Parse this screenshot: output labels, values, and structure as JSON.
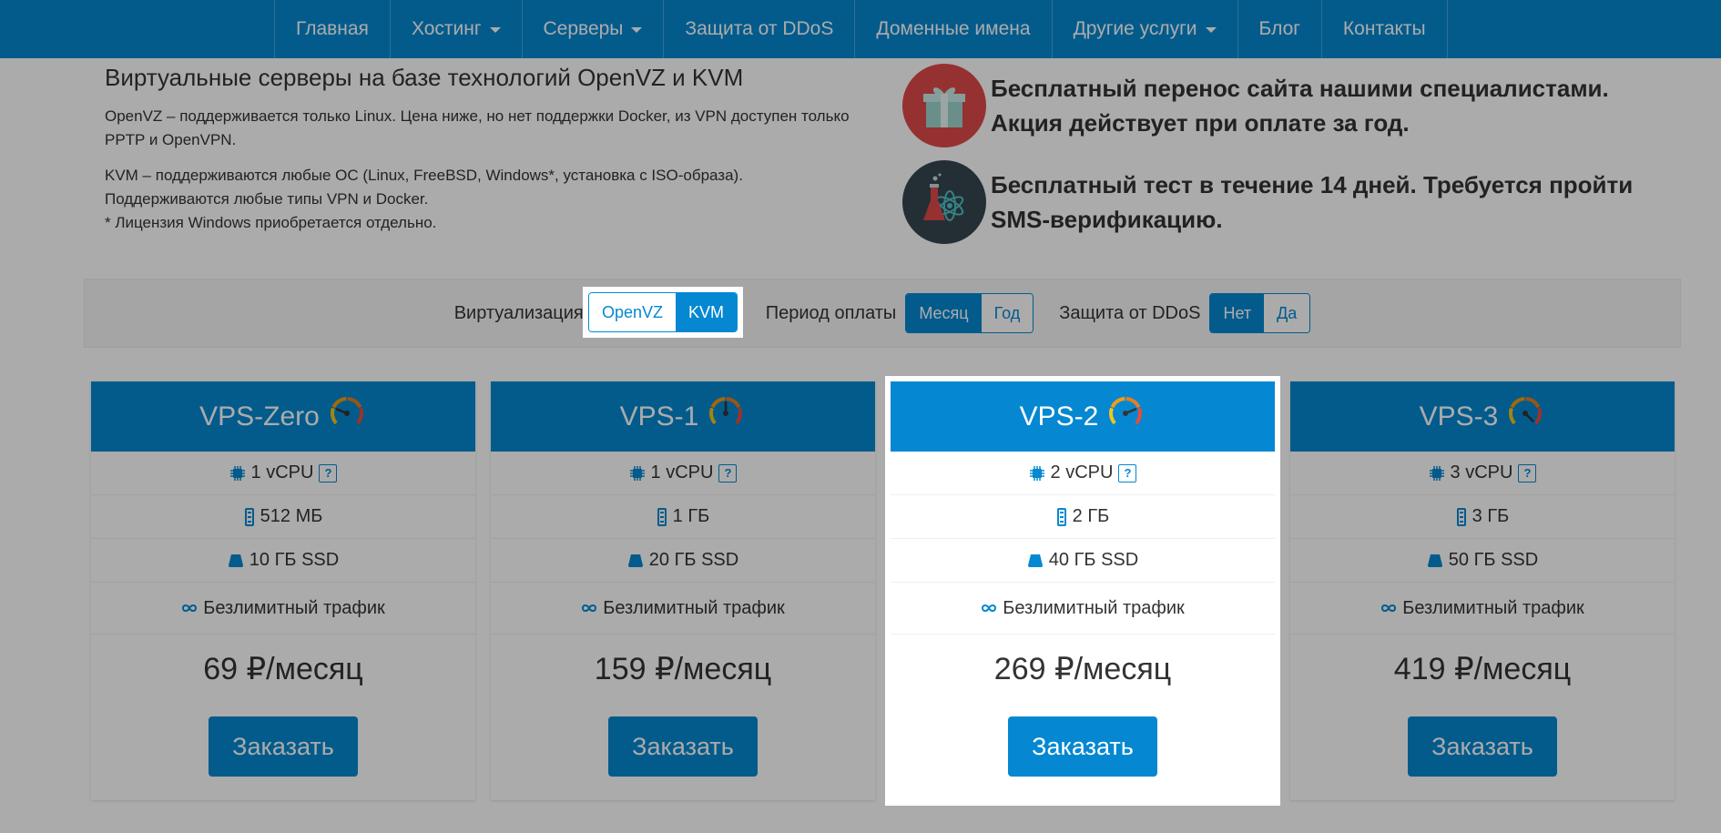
{
  "nav": {
    "items": [
      {
        "label": "Главная",
        "dropdown": false
      },
      {
        "label": "Хостинг",
        "dropdown": true
      },
      {
        "label": "Серверы",
        "dropdown": true
      },
      {
        "label": "Защита от DDoS",
        "dropdown": false
      },
      {
        "label": "Доменные имена",
        "dropdown": false
      },
      {
        "label": "Другие услуги",
        "dropdown": true
      },
      {
        "label": "Блог",
        "dropdown": false
      },
      {
        "label": "Контакты",
        "dropdown": false
      }
    ]
  },
  "intro": {
    "title": "Виртуальные серверы на базе технологий OpenVZ и KVM",
    "p1": "OpenVZ – поддерживается только Linux. Цена ниже, но нет поддержки Docker, из VPN доступен только PPTP и OpenVPN.",
    "p2_line1": "KVM – поддерживаются любые ОС (Linux, FreeBSD, Windows*, установка с ISO-образа).",
    "p2_line2": "Поддерживаются любые типы VPN и Docker.",
    "p2_line3": "* Лицензия Windows приобретается отдельно."
  },
  "promos": [
    {
      "icon": "gift-icon",
      "text_line1": "Бесплатный перенос сайта нашими специалистами.",
      "text_line2": "Акция действует при оплате за год."
    },
    {
      "icon": "flask-atom-icon",
      "text_line1": "Бесплатный тест в течение 14 дней. Требуется пройти",
      "text_line2": "SMS-верификацию."
    }
  ],
  "filters": {
    "virt_label": "Виртуализация",
    "virt_options": [
      "OpenVZ",
      "KVM"
    ],
    "virt_selected": "KVM",
    "period_label": "Период оплаты",
    "period_options": [
      "Месяц",
      "Год"
    ],
    "period_selected": "Месяц",
    "ddos_label": "Защита от DDoS",
    "ddos_options": [
      "Нет",
      "Да"
    ],
    "ddos_selected": "Нет"
  },
  "plans": [
    {
      "name": "VPS-Zero",
      "cpu": "1 vCPU",
      "ram": "512 МБ",
      "disk": "10 ГБ SSD",
      "traffic": "Безлимитный трафик",
      "price": "69 ₽/месяц",
      "order": "Заказать",
      "gauge_level": 0.25
    },
    {
      "name": "VPS-1",
      "cpu": "1 vCPU",
      "ram": "1 ГБ",
      "disk": "20 ГБ SSD",
      "traffic": "Безлимитный трафик",
      "price": "159 ₽/месяц",
      "order": "Заказать",
      "gauge_level": 0.5
    },
    {
      "name": "VPS-2",
      "cpu": "2 vCPU",
      "ram": "2 ГБ",
      "disk": "40 ГБ SSD",
      "traffic": "Безлимитный трафик",
      "price": "269 ₽/месяц",
      "order": "Заказать",
      "gauge_level": 0.75
    },
    {
      "name": "VPS-3",
      "cpu": "3 vCPU",
      "ram": "3 ГБ",
      "disk": "50 ГБ SSD",
      "traffic": "Безлимитный трафик",
      "price": "419 ₽/месяц",
      "order": "Заказать",
      "gauge_level": 1.0
    }
  ],
  "highlight": {
    "plan_index": 2,
    "filter": "virtualization"
  },
  "colors": {
    "primary": "#0588d1",
    "promo_red": "#e04a4a",
    "promo_dark": "#36474f"
  }
}
